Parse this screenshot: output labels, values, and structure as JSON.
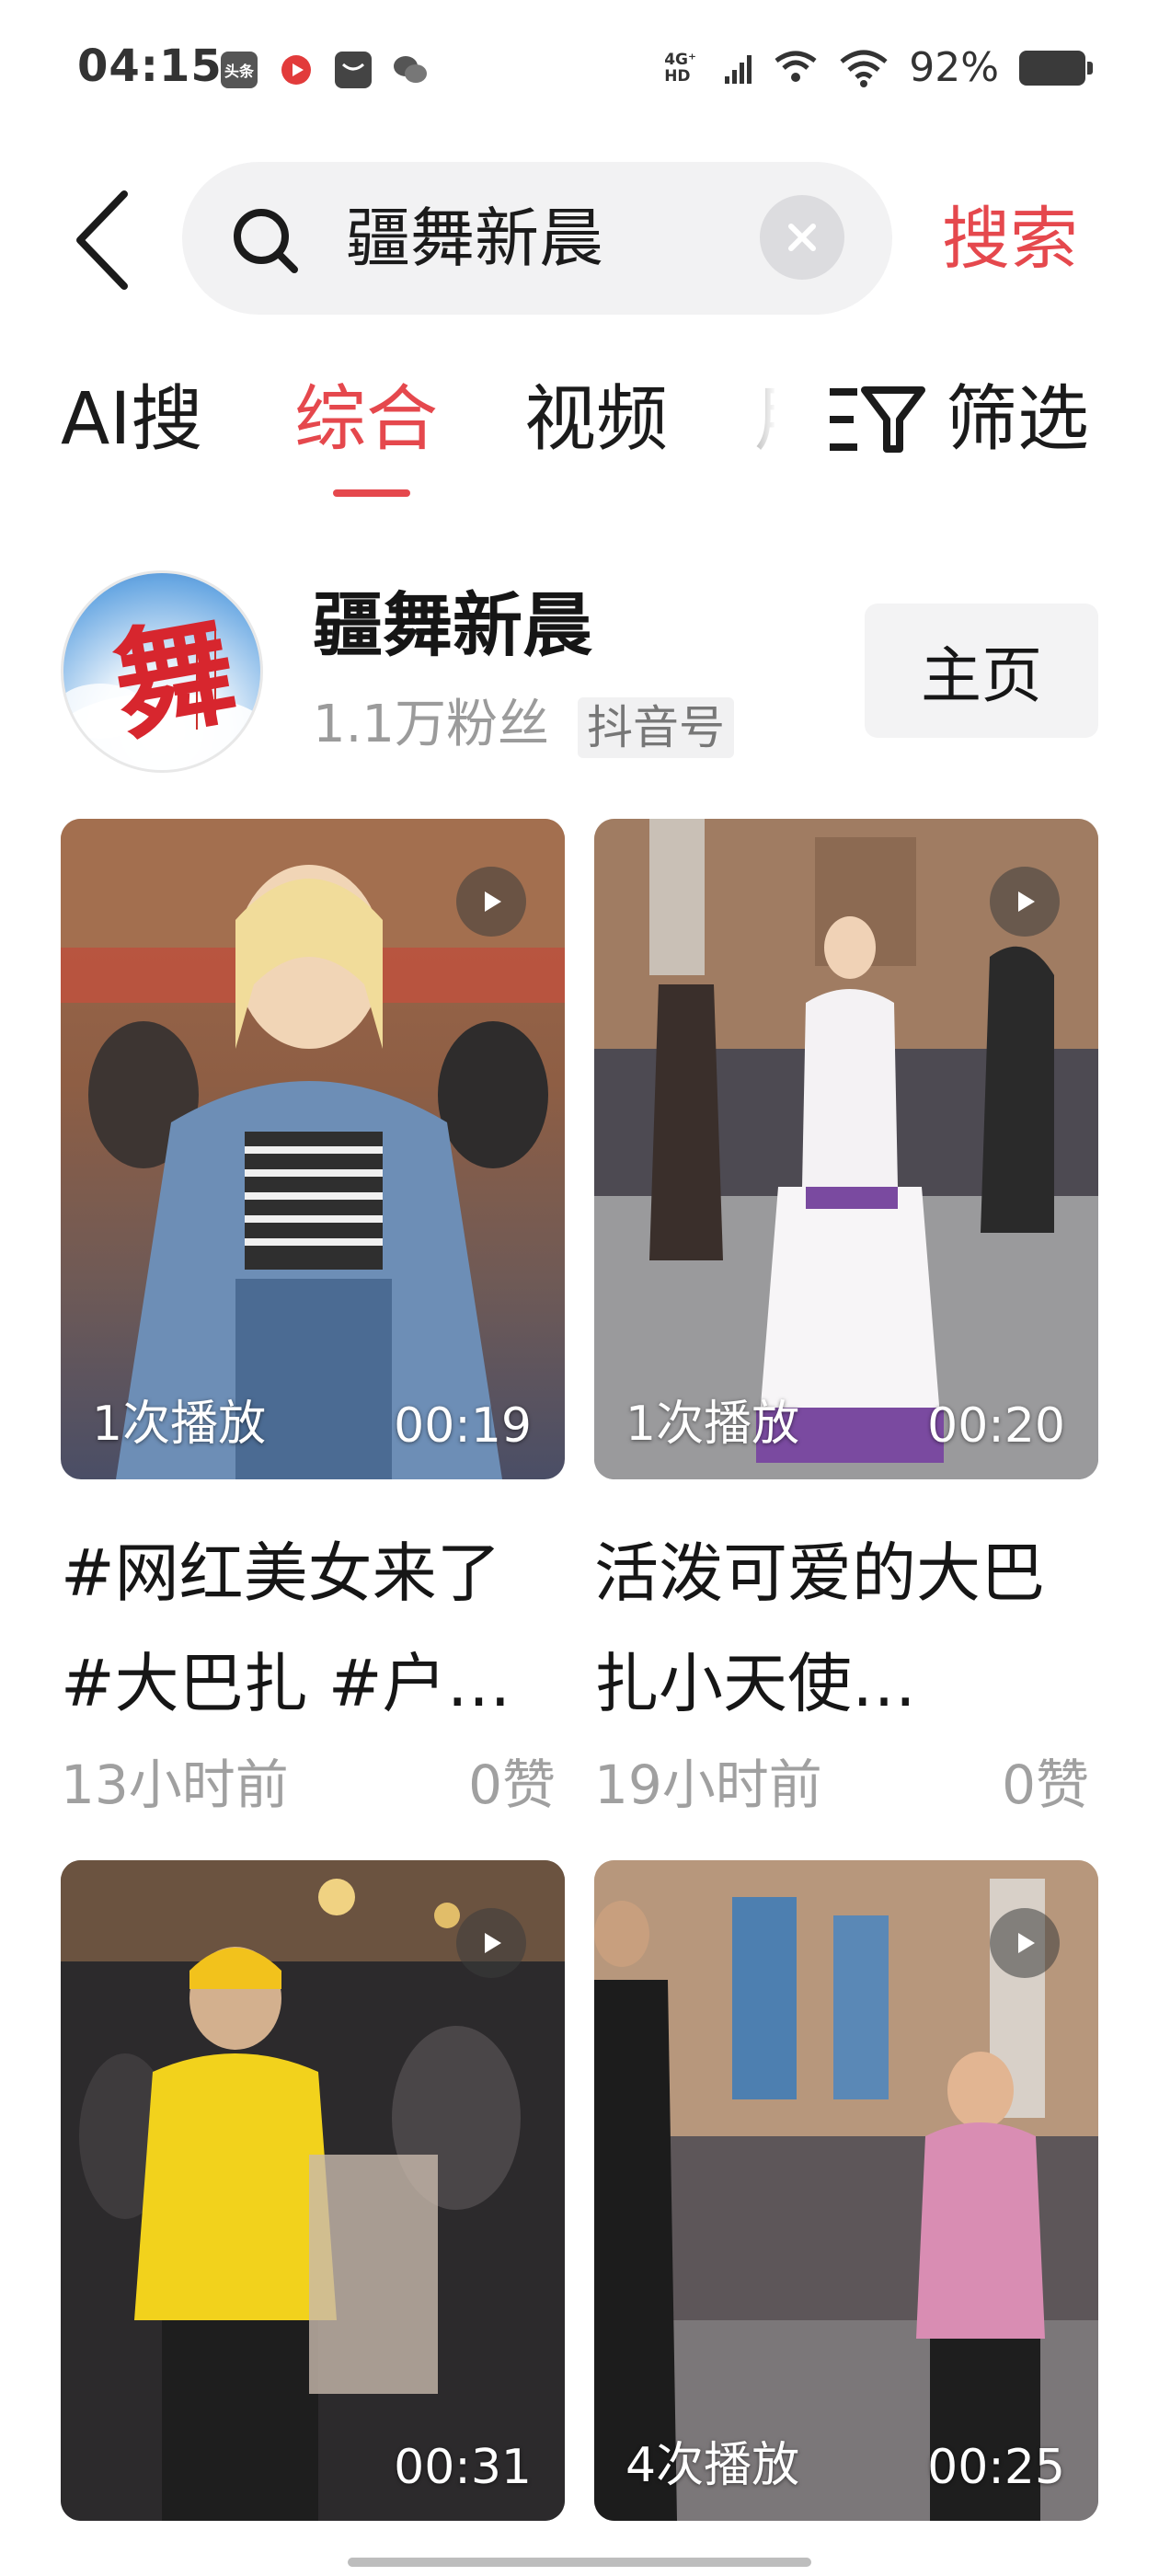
{
  "status_bar": {
    "time": "04:15",
    "network": "4G⁺ HD",
    "battery": "92%",
    "app_icons": [
      "toutiao-icon",
      "record-icon",
      "message-icon",
      "wechat-icon"
    ],
    "toutiao_label": "头条"
  },
  "search": {
    "query": "疆舞新晨",
    "submit_label": "搜索"
  },
  "tabs": [
    {
      "label": "AI搜",
      "active": false
    },
    {
      "label": "综合",
      "active": true
    },
    {
      "label": "视频",
      "active": false
    }
  ],
  "filter_label": "筛选",
  "account": {
    "name": "疆舞新晨",
    "followers": "1.1万粉丝",
    "tag": "抖音号",
    "home_button": "主页",
    "avatar_char": "舞"
  },
  "videos": [
    {
      "plays": "1次播放",
      "duration": "00:19",
      "title": "#网红美女来了 #大巴扎 #户…",
      "time": "13小时前",
      "likes": "0赞"
    },
    {
      "plays": "1次播放",
      "duration": "00:20",
      "title": "活泼可爱的大巴扎小天使…",
      "time": "19小时前",
      "likes": "0赞"
    },
    {
      "plays": "",
      "duration": "00:31"
    },
    {
      "plays": "4次播放",
      "duration": "00:25"
    }
  ],
  "colors": {
    "accent": "#e5484d",
    "muted": "#a0a0a0"
  }
}
